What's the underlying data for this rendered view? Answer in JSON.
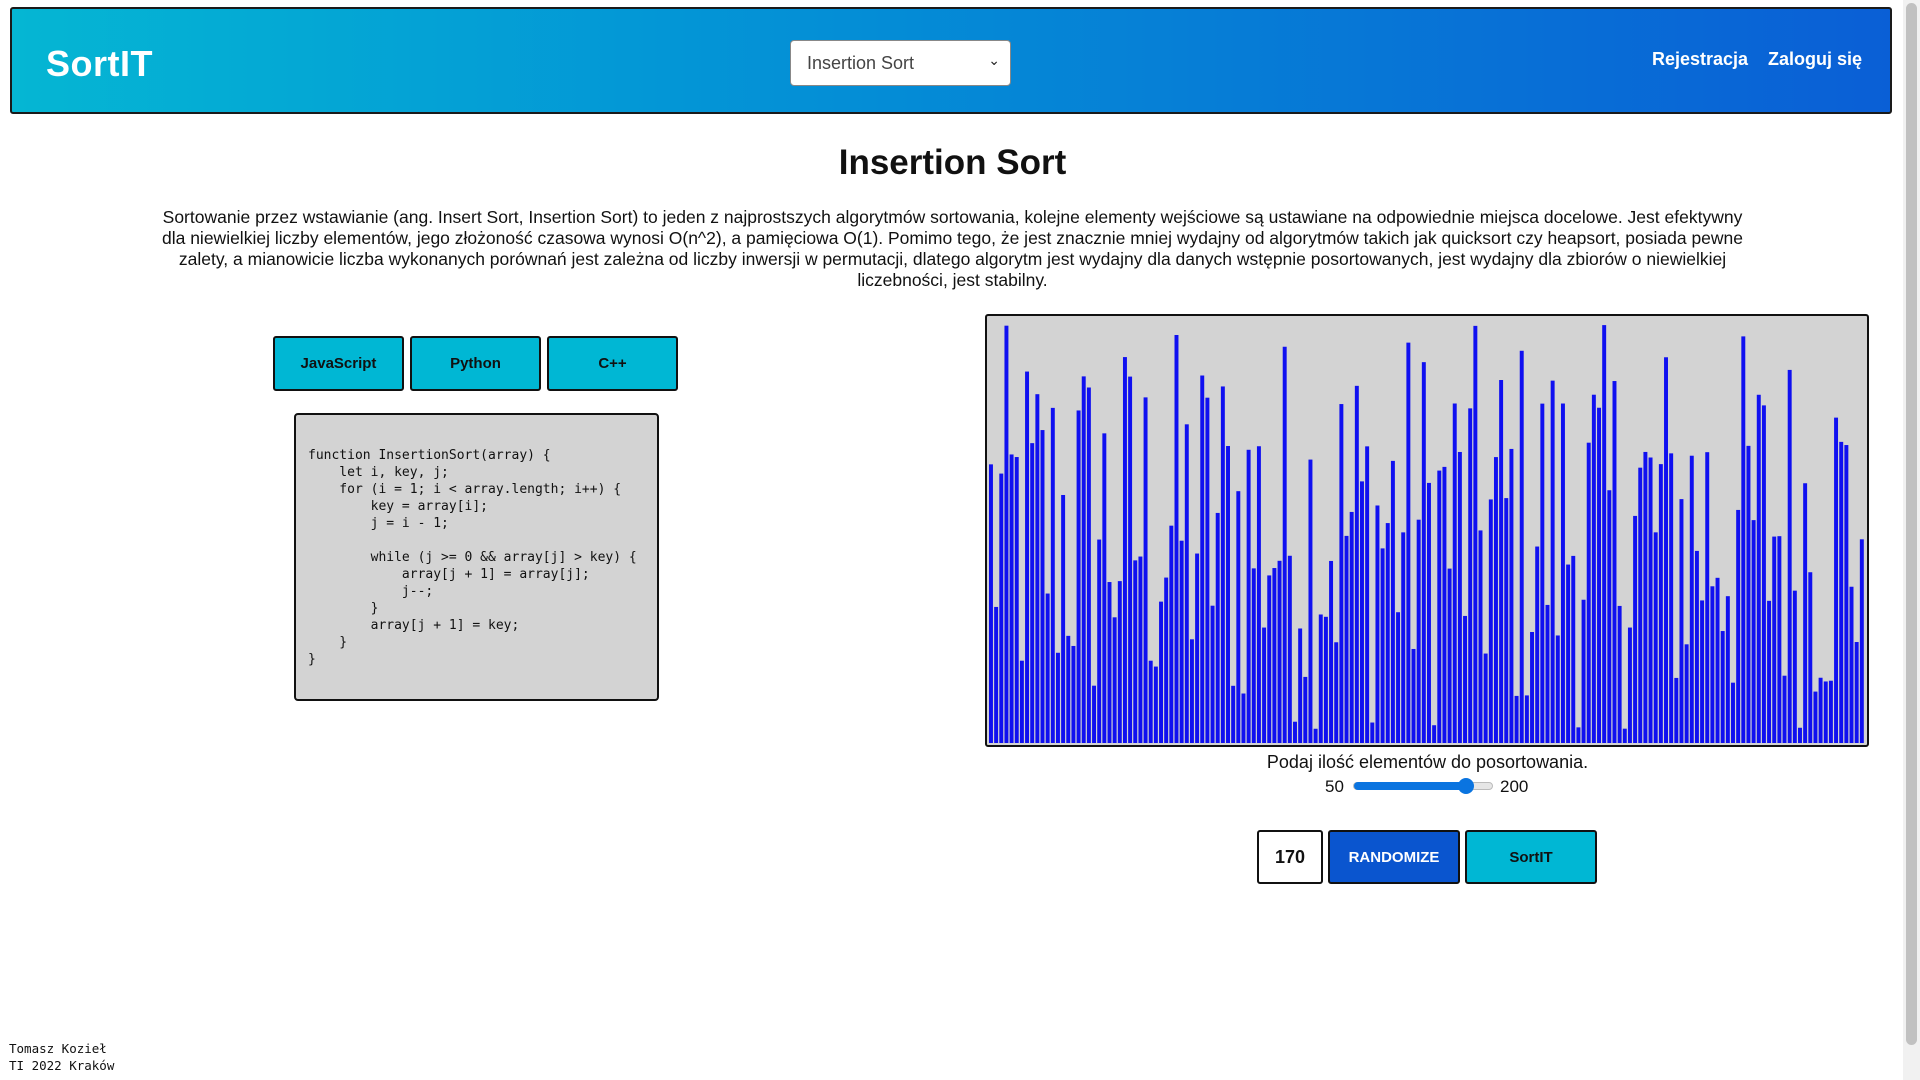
{
  "header": {
    "brand": "SortIT",
    "algorithm_select": {
      "selected": "Insertion Sort"
    },
    "nav": {
      "register": "Rejestracja",
      "login": "Zaloguj się"
    }
  },
  "main": {
    "title": "Insertion Sort",
    "description": "Sortowanie przez wstawianie (ang. Insert Sort, Insertion Sort) to jeden z najprostszych algorytmów sortowania, kolejne elementy wejściowe są ustawiane na odpowiednie miejsca docelowe. Jest efektywny dla niewielkiej liczby elementów, jego złożoność czasowa wynosi O(n^2), a pamięciowa O(1). Pomimo tego, że jest znacznie mniej wydajny od algorytmów takich jak quicksort czy heapsort, posiada pewne zalety, a mianowicie liczba wykonanych porównań jest zależna od liczby inwersji w permutacji, dlatego algorytm jest wydajny dla danych wstępnie posortowanych, jest wydajny dla zbiorów o niewielkiej liczebności, jest stabilny."
  },
  "languages": {
    "js": "JavaScript",
    "python": "Python",
    "cpp": "C++"
  },
  "code": "function InsertionSort(array) {\n    let i, key, j;\n    for (i = 1; i < array.length; i++) {\n        key = array[i];\n        j = i - 1;\n\n        while (j >= 0 && array[j] > key) {\n            array[j + 1] = array[j];\n            j--;\n        }\n        array[j + 1] = key;\n    }\n}",
  "controls": {
    "range_label": "Podaj ilość elementów do posortowania.",
    "range_min": "50",
    "range_max": "200",
    "range_value": 170,
    "count": "170",
    "randomize": "RANDOMIZE",
    "sort": "SortIT"
  },
  "colors": {
    "bar": "#1010f0",
    "bar_bg": "#d3d3d3",
    "accent": "#00b7d4",
    "primary": "#0a55cf"
  },
  "footer": {
    "line1": "Tomasz Kozieł",
    "line2": "TI 2022 Kraków"
  }
}
